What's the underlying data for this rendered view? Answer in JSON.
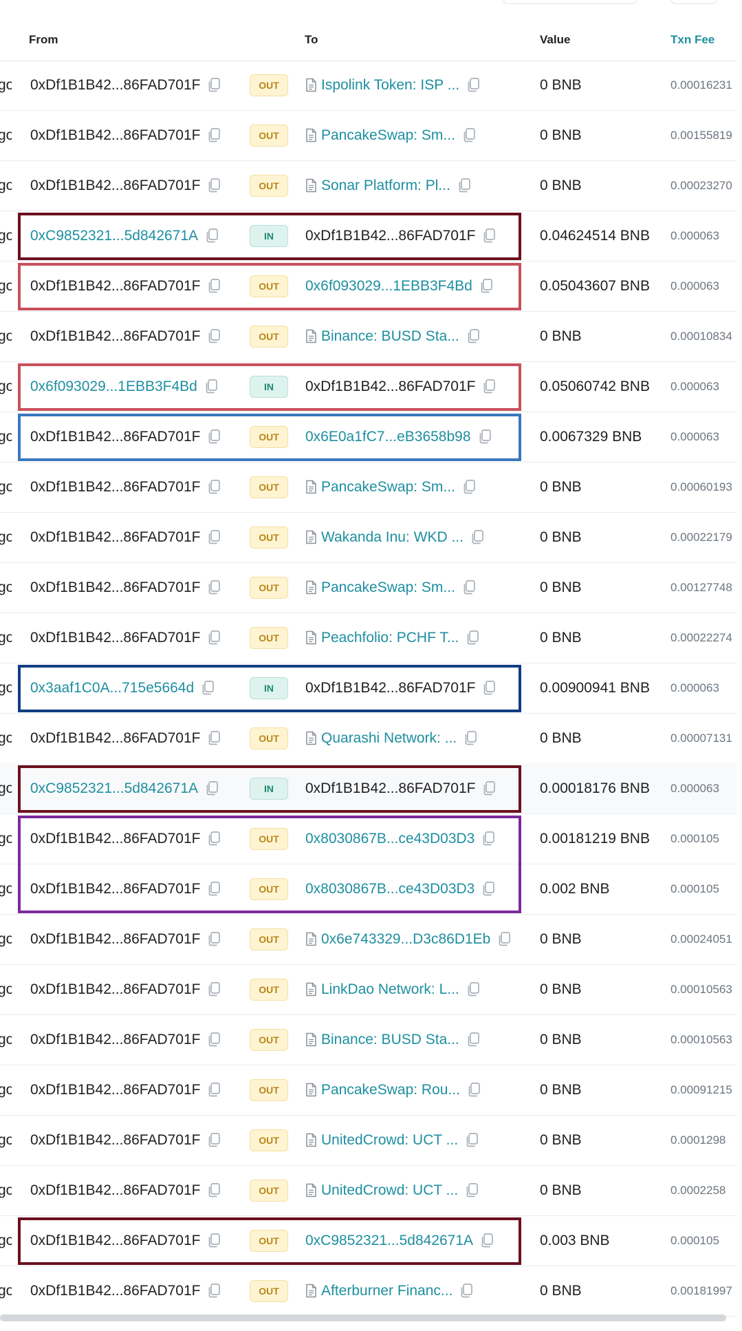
{
  "columns": {
    "age_tail": "go",
    "from": "From",
    "to": "To",
    "value": "Value",
    "fee": "Txn Fee"
  },
  "colors": {
    "link": "#1e8fa0",
    "out_badge_bg": "#fff4d2",
    "in_badge_bg": "#dff3ee"
  },
  "rows": [
    {
      "age": "go",
      "from": "0xDf1B1B42...86FAD701F",
      "from_link": false,
      "dir": "OUT",
      "to": "Ispolink Token: ISP ...",
      "to_contract": true,
      "to_link": true,
      "value": "0 BNB",
      "fee": "0.00016231"
    },
    {
      "age": "go",
      "from": "0xDf1B1B42...86FAD701F",
      "from_link": false,
      "dir": "OUT",
      "to": "PancakeSwap: Sm...",
      "to_contract": true,
      "to_link": true,
      "value": "0 BNB",
      "fee": "0.00155819"
    },
    {
      "age": "go",
      "from": "0xDf1B1B42...86FAD701F",
      "from_link": false,
      "dir": "OUT",
      "to": "Sonar Platform: Pl...",
      "to_contract": true,
      "to_link": true,
      "value": "0 BNB",
      "fee": "0.00023270"
    },
    {
      "age": "go",
      "from": "0xC9852321...5d842671A",
      "from_link": true,
      "dir": "IN",
      "to": "0xDf1B1B42...86FAD701F",
      "to_contract": false,
      "to_link": false,
      "value": "0.04624514 BNB",
      "fee": "0.000063"
    },
    {
      "age": "go",
      "from": "0xDf1B1B42...86FAD701F",
      "from_link": false,
      "dir": "OUT",
      "to": "0x6f093029...1EBB3F4Bd",
      "to_contract": false,
      "to_link": true,
      "value": "0.05043607 BNB",
      "fee": "0.000063"
    },
    {
      "age": "go",
      "from": "0xDf1B1B42...86FAD701F",
      "from_link": false,
      "dir": "OUT",
      "to": "Binance: BUSD Sta...",
      "to_contract": true,
      "to_link": true,
      "value": "0 BNB",
      "fee": "0.00010834"
    },
    {
      "age": "go",
      "from": "0x6f093029...1EBB3F4Bd",
      "from_link": true,
      "dir": "IN",
      "to": "0xDf1B1B42...86FAD701F",
      "to_contract": false,
      "to_link": false,
      "value": "0.05060742 BNB",
      "fee": "0.000063"
    },
    {
      "age": "go",
      "from": "0xDf1B1B42...86FAD701F",
      "from_link": false,
      "dir": "OUT",
      "to": "0x6E0a1fC7...eB3658b98",
      "to_contract": false,
      "to_link": true,
      "value": "0.0067329 BNB",
      "fee": "0.000063"
    },
    {
      "age": "go",
      "from": "0xDf1B1B42...86FAD701F",
      "from_link": false,
      "dir": "OUT",
      "to": "PancakeSwap: Sm...",
      "to_contract": true,
      "to_link": true,
      "value": "0 BNB",
      "fee": "0.00060193"
    },
    {
      "age": "go",
      "from": "0xDf1B1B42...86FAD701F",
      "from_link": false,
      "dir": "OUT",
      "to": "Wakanda Inu: WKD ...",
      "to_contract": true,
      "to_link": true,
      "value": "0 BNB",
      "fee": "0.00022179"
    },
    {
      "age": "go",
      "from": "0xDf1B1B42...86FAD701F",
      "from_link": false,
      "dir": "OUT",
      "to": "PancakeSwap: Sm...",
      "to_contract": true,
      "to_link": true,
      "value": "0 BNB",
      "fee": "0.00127748"
    },
    {
      "age": "go",
      "from": "0xDf1B1B42...86FAD701F",
      "from_link": false,
      "dir": "OUT",
      "to": "Peachfolio: PCHF T...",
      "to_contract": true,
      "to_link": true,
      "value": "0 BNB",
      "fee": "0.00022274"
    },
    {
      "age": "go",
      "from": "0x3aaf1C0A...715e5664d",
      "from_link": true,
      "dir": "IN",
      "to": "0xDf1B1B42...86FAD701F",
      "to_contract": false,
      "to_link": false,
      "value": "0.00900941 BNB",
      "fee": "0.000063"
    },
    {
      "age": "go",
      "from": "0xDf1B1B42...86FAD701F",
      "from_link": false,
      "dir": "OUT",
      "to": "Quarashi Network: ...",
      "to_contract": true,
      "to_link": true,
      "value": "0 BNB",
      "fee": "0.00007131"
    },
    {
      "age": "go",
      "from": "0xC9852321...5d842671A",
      "from_link": true,
      "dir": "IN",
      "to": "0xDf1B1B42...86FAD701F",
      "to_contract": false,
      "to_link": false,
      "value": "0.00018176 BNB",
      "fee": "0.000063"
    },
    {
      "age": "go",
      "from": "0xDf1B1B42...86FAD701F",
      "from_link": false,
      "dir": "OUT",
      "to": "0x8030867B...ce43D03D3",
      "to_contract": false,
      "to_link": true,
      "value": "0.00181219 BNB",
      "fee": "0.000105"
    },
    {
      "age": "go",
      "from": "0xDf1B1B42...86FAD701F",
      "from_link": false,
      "dir": "OUT",
      "to": "0x8030867B...ce43D03D3",
      "to_contract": false,
      "to_link": true,
      "value": "0.002 BNB",
      "fee": "0.000105"
    },
    {
      "age": "go",
      "from": "0xDf1B1B42...86FAD701F",
      "from_link": false,
      "dir": "OUT",
      "to": "0x6e743329...D3c86D1Eb",
      "to_contract": true,
      "to_link": true,
      "value": "0 BNB",
      "fee": "0.00024051"
    },
    {
      "age": "go",
      "from": "0xDf1B1B42...86FAD701F",
      "from_link": false,
      "dir": "OUT",
      "to": "LinkDao Network: L...",
      "to_contract": true,
      "to_link": true,
      "value": "0 BNB",
      "fee": "0.00010563"
    },
    {
      "age": "go",
      "from": "0xDf1B1B42...86FAD701F",
      "from_link": false,
      "dir": "OUT",
      "to": "Binance: BUSD Sta...",
      "to_contract": true,
      "to_link": true,
      "value": "0 BNB",
      "fee": "0.00010563"
    },
    {
      "age": "go",
      "from": "0xDf1B1B42...86FAD701F",
      "from_link": false,
      "dir": "OUT",
      "to": "PancakeSwap: Rou...",
      "to_contract": true,
      "to_link": true,
      "value": "0 BNB",
      "fee": "0.00091215"
    },
    {
      "age": "go",
      "from": "0xDf1B1B42...86FAD701F",
      "from_link": false,
      "dir": "OUT",
      "to": "UnitedCrowd: UCT ...",
      "to_contract": true,
      "to_link": true,
      "value": "0 BNB",
      "fee": "0.0001298"
    },
    {
      "age": "go",
      "from": "0xDf1B1B42...86FAD701F",
      "from_link": false,
      "dir": "OUT",
      "to": "UnitedCrowd: UCT ...",
      "to_contract": true,
      "to_link": true,
      "value": "0 BNB",
      "fee": "0.0002258"
    },
    {
      "age": "go",
      "from": "0xDf1B1B42...86FAD701F",
      "from_link": false,
      "dir": "OUT",
      "to": "0xC9852321...5d842671A",
      "to_contract": false,
      "to_link": true,
      "value": "0.003 BNB",
      "fee": "0.000105"
    },
    {
      "age": "go",
      "from": "0xDf1B1B42...86FAD701F",
      "from_link": false,
      "dir": "OUT",
      "to": "Afterburner Financ...",
      "to_contract": true,
      "to_link": true,
      "value": "0 BNB",
      "fee": "0.00181997"
    }
  ],
  "highlights": [
    {
      "color": "#6b1020",
      "rows": [
        3,
        3
      ]
    },
    {
      "color": "#c8505c",
      "rows": [
        4,
        4
      ]
    },
    {
      "color": "#c8505c",
      "rows": [
        6,
        6
      ]
    },
    {
      "color": "#3a78c0",
      "rows": [
        7,
        7
      ]
    },
    {
      "color": "#103d82",
      "rows": [
        12,
        12
      ]
    },
    {
      "color": "#6b1020",
      "rows": [
        14,
        14
      ]
    },
    {
      "color": "#7a2a9c",
      "rows": [
        15,
        16
      ]
    },
    {
      "color": "#6b1020",
      "rows": [
        23,
        23
      ]
    }
  ]
}
